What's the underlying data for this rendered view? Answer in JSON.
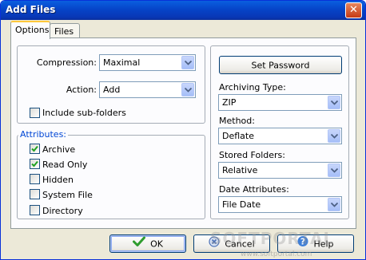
{
  "window": {
    "title": "Add Files"
  },
  "tabs": [
    {
      "label": "Options",
      "active": true
    },
    {
      "label": "Files",
      "active": false
    }
  ],
  "left": {
    "compression": {
      "label": "Compression:",
      "value": "Maximal"
    },
    "action": {
      "label": "Action:",
      "value": "Add"
    },
    "include_subfolders": {
      "label": "Include sub-folders",
      "checked": false
    },
    "attributes": {
      "label": "Attributes:",
      "items": [
        {
          "label": "Archive",
          "checked": true
        },
        {
          "label": "Read Only",
          "checked": true
        },
        {
          "label": "Hidden",
          "checked": false
        },
        {
          "label": "System File",
          "checked": false
        },
        {
          "label": "Directory",
          "checked": false
        }
      ]
    }
  },
  "right": {
    "set_password_label": "Set Password",
    "archiving_type": {
      "label": "Archiving Type:",
      "value": "ZIP"
    },
    "method": {
      "label": "Method:",
      "value": "Deflate"
    },
    "stored_folders": {
      "label": "Stored Folders:",
      "value": "Relative"
    },
    "date_attributes": {
      "label": "Date Attributes:",
      "value": "File Date"
    }
  },
  "buttons": {
    "ok": "OK",
    "cancel": "Cancel",
    "help": "Help"
  },
  "watermark": {
    "text": "SOFTPORTAL",
    "url": "www.softportal.com"
  },
  "colors": {
    "title_bar": "#0644c8",
    "group_label": "#0046d5",
    "ok_check": "#2e9c2e"
  },
  "icons": [
    "close-icon",
    "chevron-down-icon",
    "checkmark-icon",
    "ok-check-icon",
    "cancel-icon",
    "help-icon"
  ]
}
